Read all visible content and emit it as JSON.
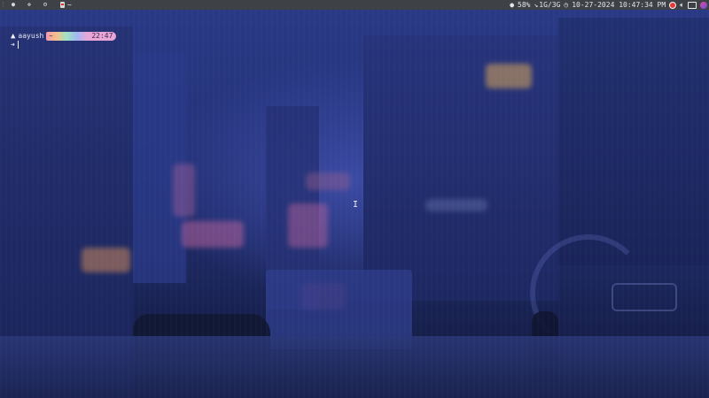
{
  "topbar": {
    "workspaces": [
      {
        "icon": "circle-dot-icon",
        "glyph": "●"
      },
      {
        "icon": "move-icon",
        "glyph": "✥"
      },
      {
        "icon": "settings-icon",
        "glyph": "⚙"
      }
    ],
    "active_window_title": "~",
    "battery": "58%",
    "memory": "1G/3G",
    "datetime": "10-27-2024 10:47:34 PM"
  },
  "terminal": {
    "user": "aayush",
    "path_segment": "~",
    "time": "22:47",
    "prompt_symbol": "➜"
  },
  "colors": {
    "topbar_bg": "#3e4146",
    "prompt_time_bg": "#e8a6d8",
    "wallpaper_tint": "#24327a"
  }
}
